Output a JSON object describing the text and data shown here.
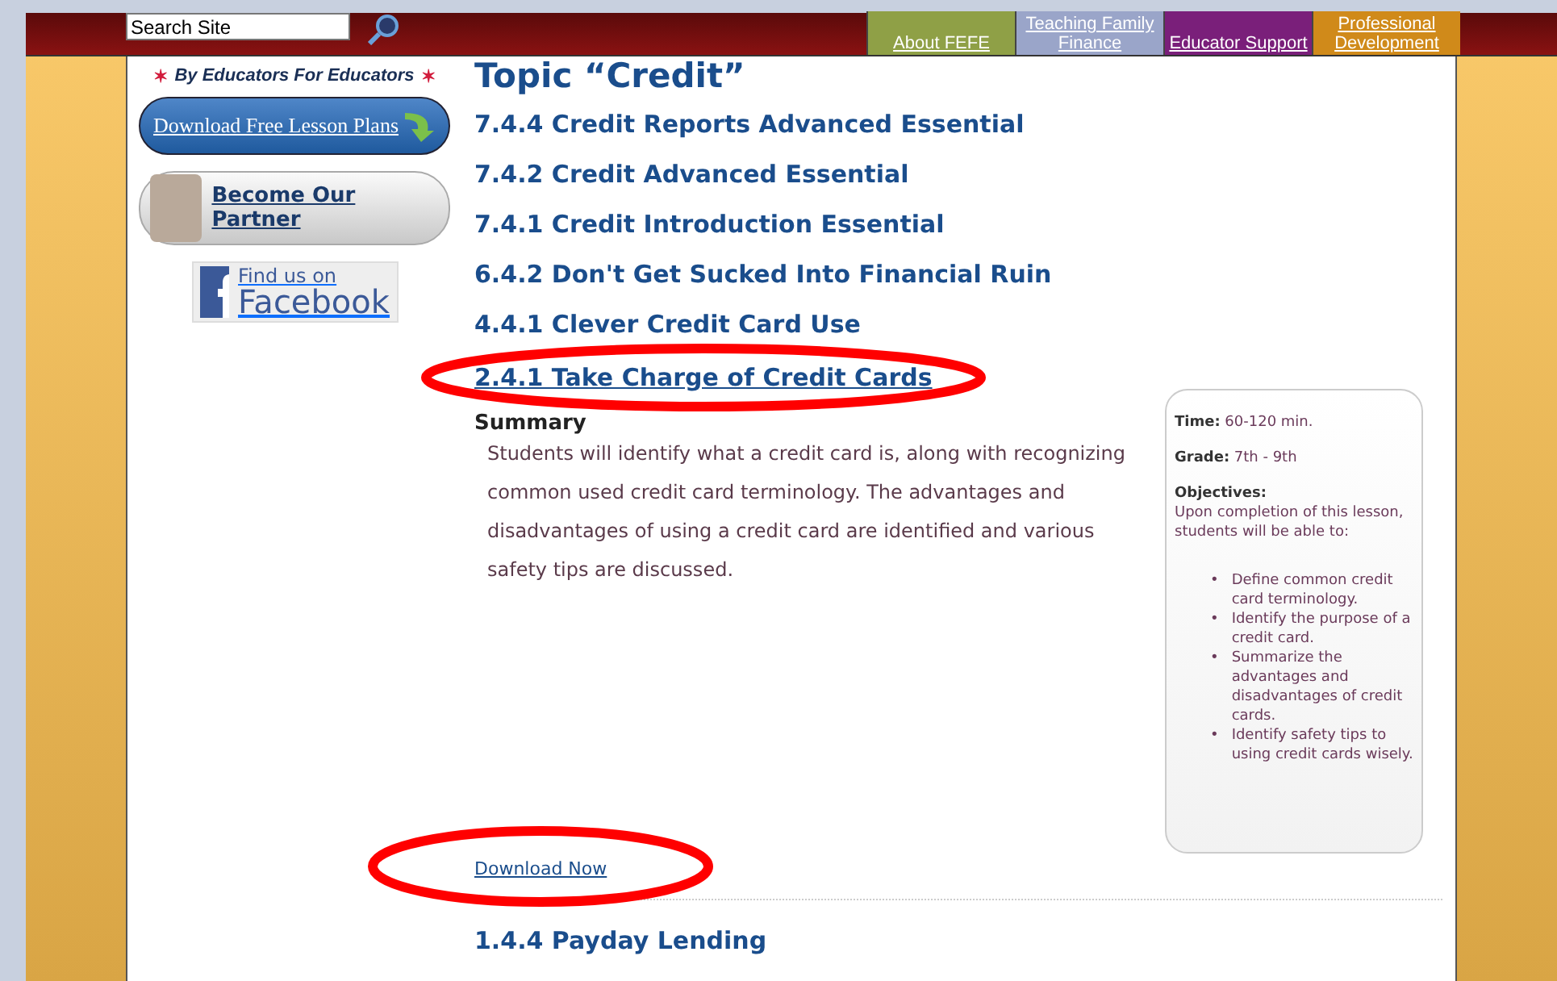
{
  "header": {
    "search": {
      "value": "Search Site"
    },
    "nav": [
      {
        "label": "About FEFE",
        "color": "#8fa046"
      },
      {
        "label": "Teaching Family Finance",
        "color": "#9aa5c9"
      },
      {
        "label": "Educator Support",
        "color": "#7a1f7a"
      },
      {
        "label": "Professional Development",
        "color": "#d08a1a"
      }
    ]
  },
  "sidebar": {
    "star_left": "✶",
    "tagline": "By Educators For Educators",
    "star_right": "✶",
    "buttons": [
      {
        "kind": "lesson",
        "label": "Download Free Lesson Plans"
      },
      {
        "kind": "partner",
        "label": "Become Our Partner"
      }
    ],
    "facebook": {
      "line1": "Find us on",
      "line2": "Facebook"
    }
  },
  "main": {
    "title": "Topic “Credit”",
    "topics": [
      {
        "label": "7.4.4 Credit Reports Advanced Essential",
        "circled": false
      },
      {
        "label": "7.4.2 Credit Advanced Essential",
        "circled": false
      },
      {
        "label": "7.4.1 Credit Introduction Essential",
        "circled": false
      },
      {
        "label": "6.4.2 Don't Get Sucked Into Financial Ruin",
        "circled": false
      },
      {
        "label": "4.4.1 Clever Credit Card Use",
        "circled": false
      },
      {
        "label": "2.4.1 Take Charge of Credit Cards",
        "circled": true
      }
    ],
    "summary_heading": "Summary",
    "summary": "Students will identify what a credit card is, along with recognizing common used credit card terminology. The advantages and disadvantages of using a credit card are identified and various safety tips are discussed.",
    "info": {
      "time_label": "Time:",
      "time": "60-120 min.",
      "grade_label": "Grade:",
      "grade": "7th - 9th",
      "objectives_label": "Objectives:",
      "objectives_intro": "Upon completion of this lesson, students will be able to:",
      "objectives": [
        {
          "bullet": "•",
          "text": "Define common credit card terminology."
        },
        {
          "bullet": "•",
          "text": "Identify the purpose of a credit card."
        },
        {
          "bullet": "•",
          "text": "Summarize the advantages and disadvantages of credit cards."
        },
        {
          "bullet": "•",
          "text": "Identify safety tips to using credit cards wisely."
        }
      ]
    },
    "download": {
      "label": "Download Now",
      "circled": true
    },
    "next_topic": "1.4.4 Payday Lending"
  }
}
